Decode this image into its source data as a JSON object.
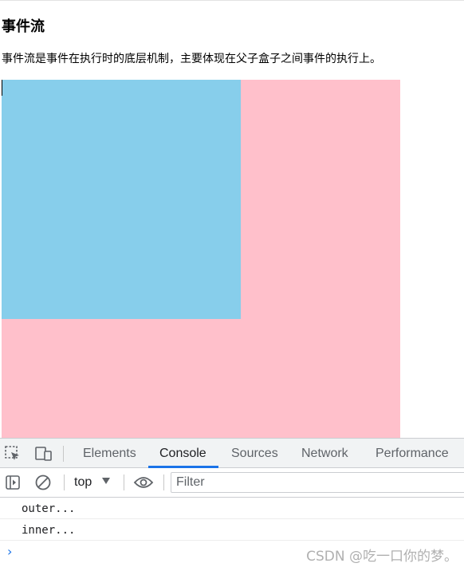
{
  "page": {
    "title": "事件流",
    "description": "事件流是事件在执行时的底层机制，主要体现在父子盒子之间事件的执行上。"
  },
  "boxes": {
    "outer_color": "#ffc0cb",
    "inner_color": "#87ceeb"
  },
  "devtools": {
    "tabs": [
      "Elements",
      "Console",
      "Sources",
      "Network",
      "Performance"
    ],
    "active_tab": "Console",
    "icons": {
      "inspect": "inspect-element-icon",
      "device": "device-toolbar-icon",
      "sidebar": "sidebar-toggle-icon",
      "clear": "clear-console-icon",
      "eye": "live-expression-icon"
    },
    "context": "top",
    "filter_placeholder": "Filter",
    "console_logs": [
      "outer...",
      "inner..."
    ],
    "prompt_symbol": "›",
    "accent_color": "#1a73e8"
  },
  "watermark": "CSDN @吃一口你的梦。"
}
